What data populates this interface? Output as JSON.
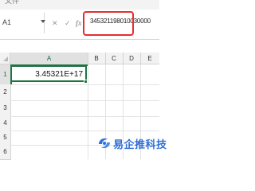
{
  "top_partial_label": "文件",
  "name_box": {
    "value": "A1"
  },
  "formula_bar": {
    "cancel_symbol": "✕",
    "enter_symbol": "✓",
    "fx_label": "fx",
    "value": "345321198010030000"
  },
  "columns": [
    "A",
    "B",
    "C",
    "D",
    "E"
  ],
  "rows": [
    "1",
    "2",
    "3",
    "4",
    "5",
    "6"
  ],
  "cells": {
    "A1": "3.45321E+17"
  },
  "selected_cell": "A1",
  "highlight_color": "#e32f2f",
  "accent_color": "#217346",
  "watermark": {
    "text": "易企推科技",
    "color": "#2f6fd6"
  }
}
